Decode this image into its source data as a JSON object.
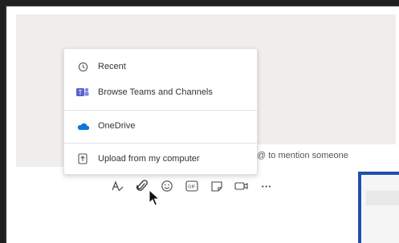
{
  "compose": {
    "hint": "@ to mention someone"
  },
  "attach_menu": {
    "items": [
      {
        "label": "Recent",
        "icon": "clock-icon"
      },
      {
        "label": "Browse Teams and Channels",
        "icon": "teams-icon"
      },
      {
        "label": "OneDrive",
        "icon": "onedrive-icon"
      },
      {
        "label": "Upload from my computer",
        "icon": "upload-icon"
      }
    ]
  },
  "toolbar": {
    "items": [
      {
        "icon": "format-icon"
      },
      {
        "icon": "attach-icon"
      },
      {
        "icon": "emoji-icon"
      },
      {
        "icon": "gif-icon",
        "label": "GIF"
      },
      {
        "icon": "sticker-icon"
      },
      {
        "icon": "meet-now-icon"
      },
      {
        "icon": "more-options-icon",
        "label": "···"
      }
    ]
  },
  "colors": {
    "chat_background": "#f0eeed",
    "teams_purple": "#5b5fc7",
    "onedrive_blue": "#0f78d4",
    "panel_border": "#1f4fb0"
  }
}
